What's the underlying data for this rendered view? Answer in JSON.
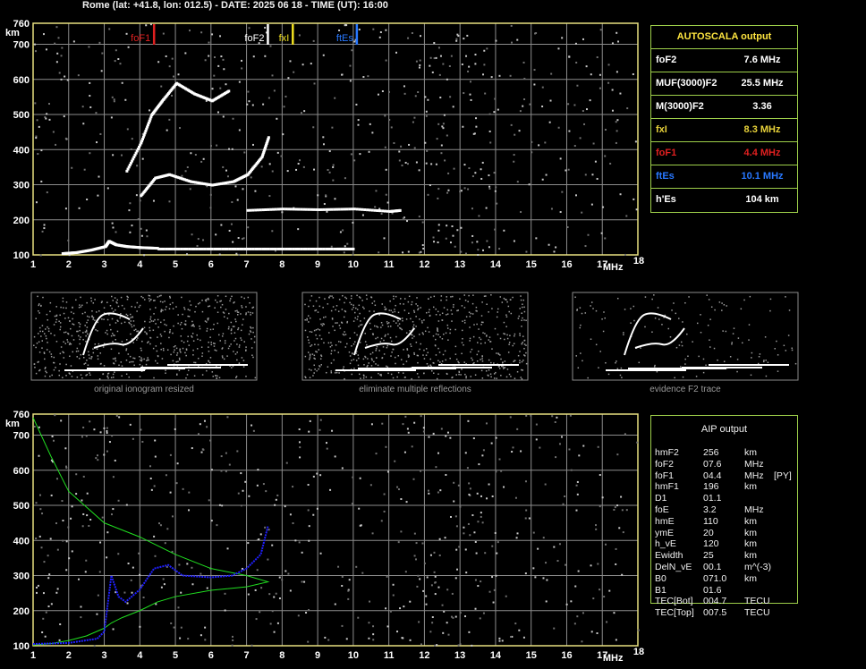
{
  "header": "Rome (lat: +41.8, lon: 012.5) - DATE: 2025 06 18 - TIME (UT): 16:00",
  "colors": {
    "fof1": "#e02020",
    "fof2": "#ffffff",
    "fxi": "#f0e020",
    "ftes": "#2878ff",
    "grid": "#8c8c8c",
    "axis": "#e8e080",
    "green": "#20e020",
    "blue": "#2020ff"
  },
  "autoscala": {
    "title": "AUTOSCALA output",
    "rows": [
      {
        "label": "foF2",
        "value": "7.6 MHz",
        "color": "#ffffff"
      },
      {
        "label": "MUF(3000)F2",
        "value": "25.5 MHz",
        "color": "#ffffff"
      },
      {
        "label": "M(3000)F2",
        "value": "3.36",
        "color": "#ffffff"
      },
      {
        "label": "fxI",
        "value": "8.3 MHz",
        "color": "#e8d23a"
      },
      {
        "label": "foF1",
        "value": "4.4 MHz",
        "color": "#e02020"
      },
      {
        "label": "ftEs",
        "value": "10.1 MHz",
        "color": "#2878ff"
      },
      {
        "label": "h'Es",
        "value": "104    km",
        "color": "#ffffff"
      }
    ]
  },
  "aip": {
    "title": "AIP output",
    "rows": [
      {
        "label": "hmF2",
        "value": "256",
        "unit": "km",
        "extra": ""
      },
      {
        "label": "foF2",
        "value": "07.6",
        "unit": "MHz",
        "extra": ""
      },
      {
        "label": "foF1",
        "value": "04.4",
        "unit": "MHz",
        "extra": "[PY]"
      },
      {
        "label": "hmF1",
        "value": "196",
        "unit": "km",
        "extra": ""
      },
      {
        "label": "D1",
        "value": "01.1",
        "unit": "",
        "extra": ""
      },
      {
        "label": "foE",
        "value": "3.2",
        "unit": "MHz",
        "extra": ""
      },
      {
        "label": "hmE",
        "value": "110",
        "unit": "km",
        "extra": ""
      },
      {
        "label": "ymE",
        "value": "20",
        "unit": "km",
        "extra": ""
      },
      {
        "label": "h_vE",
        "value": "120",
        "unit": "km",
        "extra": ""
      },
      {
        "label": "Ewidth",
        "value": "25",
        "unit": "km",
        "extra": ""
      },
      {
        "label": "DelN_vE",
        "value": "00.1",
        "unit": "m^(-3)",
        "extra": ""
      },
      {
        "label": "B0",
        "value": "071.0",
        "unit": "km",
        "extra": ""
      },
      {
        "label": "B1",
        "value": "01.6",
        "unit": "",
        "extra": ""
      },
      {
        "label": "TEC[Bot]",
        "value": "004.7",
        "unit": "TECU",
        "extra": ""
      },
      {
        "label": "TEC[Top]",
        "value": "007.5",
        "unit": "TECU",
        "extra": ""
      }
    ]
  },
  "captions": [
    "original ionogram resized",
    "eliminate multiple reflections",
    "evidence F2 trace"
  ],
  "chart_data": [
    {
      "type": "scatter",
      "panel": "top ionogram",
      "xlabel": "MHz",
      "ylabel": "km",
      "xlim": [
        1,
        18
      ],
      "ylim": [
        100,
        760
      ],
      "xticks": [
        1,
        2,
        3,
        4,
        5,
        6,
        7,
        8,
        9,
        10,
        11,
        12,
        13,
        14,
        15,
        16,
        17,
        18
      ],
      "yticks": [
        100,
        200,
        300,
        400,
        500,
        600,
        700,
        760
      ],
      "markers": [
        {
          "name": "foF1",
          "x": 4.4
        },
        {
          "name": "foF2",
          "x": 7.6
        },
        {
          "name": "fxI",
          "x": 8.3
        },
        {
          "name": "ftEs",
          "x": 10.1
        }
      ],
      "traces": [
        {
          "name": "E/Es",
          "x": [
            1.8,
            2.2,
            2.6,
            3.0,
            3.1,
            3.3,
            3.6,
            4.0,
            4.5
          ],
          "y": [
            105,
            108,
            115,
            125,
            140,
            130,
            125,
            122,
            120
          ]
        },
        {
          "name": "Es flat",
          "x": [
            4.5,
            5.5,
            6.5,
            7.5,
            8.5,
            9.5,
            10.0
          ],
          "y": [
            118,
            118,
            118,
            118,
            118,
            118,
            118
          ]
        },
        {
          "name": "F1/F2 O-trace",
          "x": [
            4.0,
            4.4,
            4.8,
            5.4,
            6.0,
            6.6,
            7.0,
            7.4,
            7.6
          ],
          "y": [
            270,
            320,
            330,
            310,
            300,
            310,
            330,
            380,
            440
          ]
        },
        {
          "name": "X-trace",
          "x": [
            3.6,
            4.0,
            4.3,
            4.6,
            5.0,
            5.5,
            6.0,
            6.5
          ],
          "y": [
            340,
            420,
            500,
            540,
            590,
            560,
            540,
            570
          ]
        },
        {
          "name": "Es multiple",
          "x": [
            7.0,
            8.0,
            9.0,
            10.0,
            11.0,
            11.3
          ],
          "y": [
            228,
            232,
            230,
            232,
            225,
            228
          ]
        }
      ]
    },
    {
      "type": "line",
      "panel": "bottom ionogram with AIP profile",
      "xlabel": "MHz",
      "ylabel": "km",
      "xlim": [
        1,
        18
      ],
      "ylim": [
        100,
        760
      ],
      "xticks": [
        1,
        2,
        3,
        4,
        5,
        6,
        7,
        8,
        9,
        10,
        11,
        12,
        13,
        14,
        15,
        16,
        17,
        18
      ],
      "yticks": [
        100,
        200,
        300,
        400,
        500,
        600,
        700,
        760
      ],
      "series": [
        {
          "name": "electron density profile",
          "color": "green",
          "x": [
            1.0,
            1.5,
            2.0,
            3.0,
            4.0,
            5.0,
            6.0,
            7.0,
            7.6,
            7.0,
            6.0,
            5.0,
            4.5,
            4.0,
            3.5,
            3.2,
            3.0,
            2.5,
            2.0,
            1.5,
            1.0
          ],
          "y": [
            750,
            640,
            540,
            450,
            410,
            360,
            320,
            300,
            282,
            268,
            258,
            240,
            225,
            200,
            180,
            165,
            150,
            128,
            115,
            106,
            102
          ]
        },
        {
          "name": "virtual height trace",
          "color": "blue",
          "x": [
            1.0,
            2.0,
            2.8,
            3.0,
            3.2,
            3.4,
            3.6,
            4.0,
            4.4,
            4.8,
            5.2,
            6.0,
            6.6,
            7.0,
            7.4,
            7.6
          ],
          "y": [
            105,
            108,
            120,
            140,
            300,
            240,
            225,
            260,
            320,
            330,
            300,
            295,
            300,
            320,
            360,
            440
          ]
        }
      ]
    }
  ]
}
